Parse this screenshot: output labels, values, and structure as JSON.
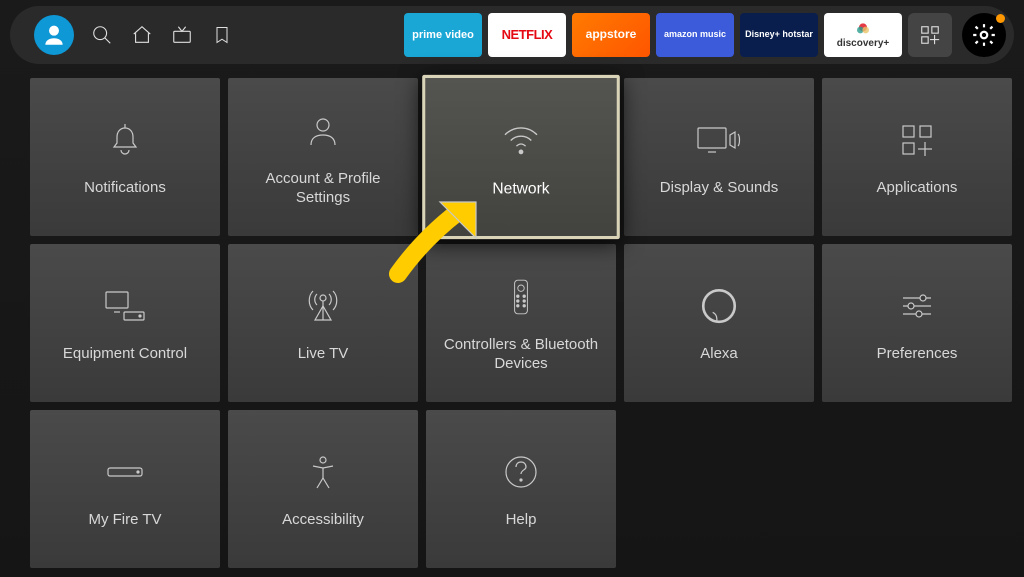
{
  "topbar": {
    "apps": [
      {
        "id": "prime",
        "class": "app-prime",
        "label": "prime video"
      },
      {
        "id": "netflix",
        "class": "app-netflix",
        "label": "NETFLIX"
      },
      {
        "id": "appstore",
        "class": "app-appstore",
        "label": "appstore"
      },
      {
        "id": "music",
        "class": "app-music",
        "label": "amazon music"
      },
      {
        "id": "hotstar",
        "class": "app-hotstar",
        "label": "Disney+ hotstar"
      },
      {
        "id": "discovery",
        "class": "app-discovery",
        "label": "discovery+"
      }
    ]
  },
  "tiles": {
    "notifications": {
      "label": "Notifications"
    },
    "account": {
      "label": "Account & Profile Settings"
    },
    "network": {
      "label": "Network",
      "selected": true
    },
    "display": {
      "label": "Display & Sounds"
    },
    "applications": {
      "label": "Applications"
    },
    "equipment": {
      "label": "Equipment Control"
    },
    "livetv": {
      "label": "Live TV"
    },
    "controllers": {
      "label": "Controllers & Bluetooth Devices"
    },
    "alexa": {
      "label": "Alexa"
    },
    "preferences": {
      "label": "Preferences"
    },
    "firetv": {
      "label": "My Fire TV"
    },
    "accessibility": {
      "label": "Accessibility"
    },
    "help": {
      "label": "Help"
    }
  },
  "annotation": {
    "type": "arrow",
    "color": "#ffcc00",
    "points_to": "network"
  }
}
